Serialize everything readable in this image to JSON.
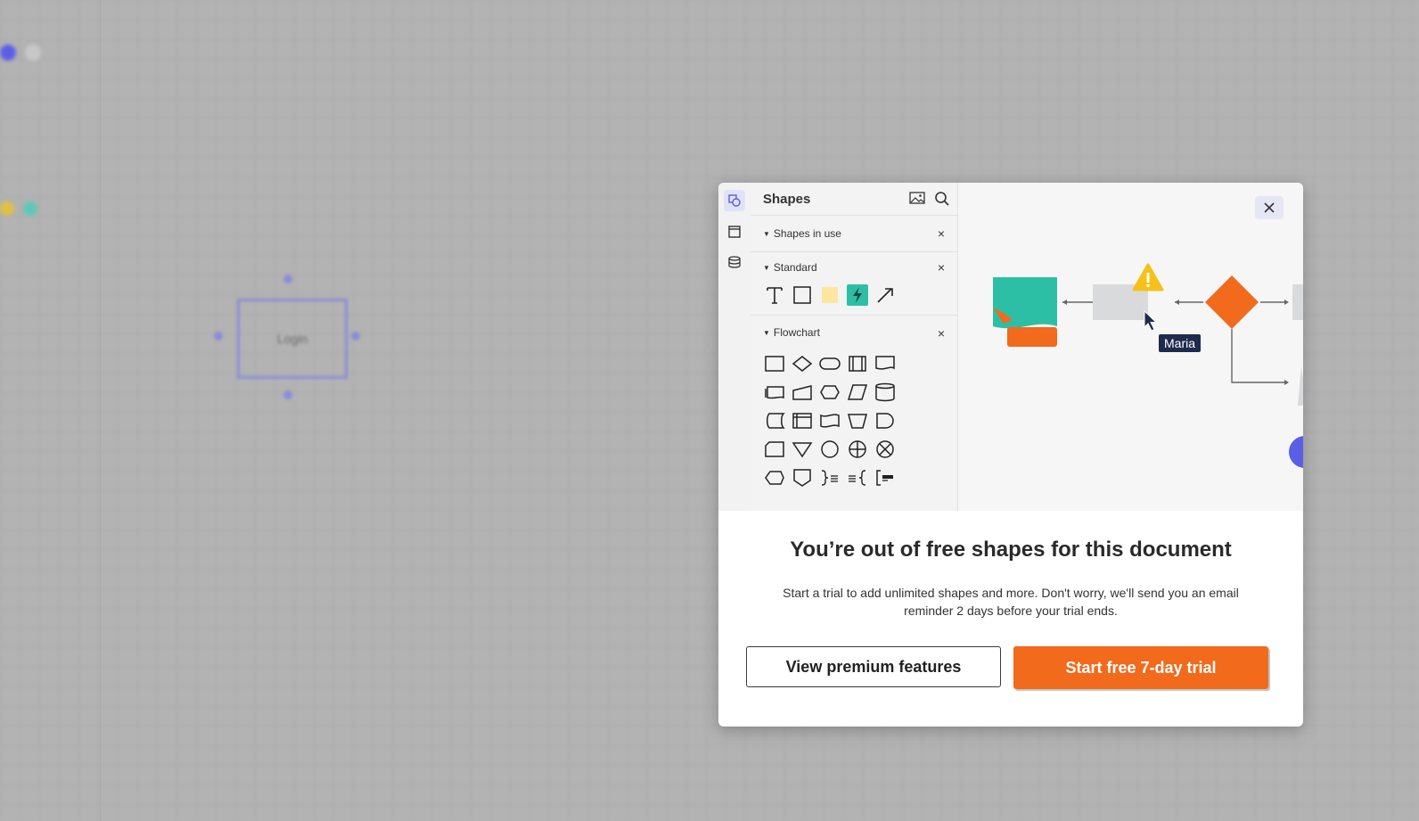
{
  "background": {
    "shape_label": "Login"
  },
  "modal": {
    "close_icon": "close-icon",
    "preview": {
      "panel_title": "Shapes",
      "sections": [
        {
          "label": "Shapes in use"
        },
        {
          "label": "Standard"
        },
        {
          "label": "Flowchart"
        }
      ],
      "cursor_name": "Maria"
    },
    "headline": "You’re out of free shapes for this document",
    "subtext": "Start a trial to add unlimited shapes and more. Don't worry, we'll send you an email reminder 2 days before your trial ends.",
    "secondary_button": "View premium features",
    "primary_button": "Start free 7-day trial"
  },
  "colors": {
    "accent_orange": "#f26a1b",
    "teal": "#2dbfa6",
    "warning_yellow": "#f5c21b",
    "cursor_tag": "#1f2b4d"
  }
}
